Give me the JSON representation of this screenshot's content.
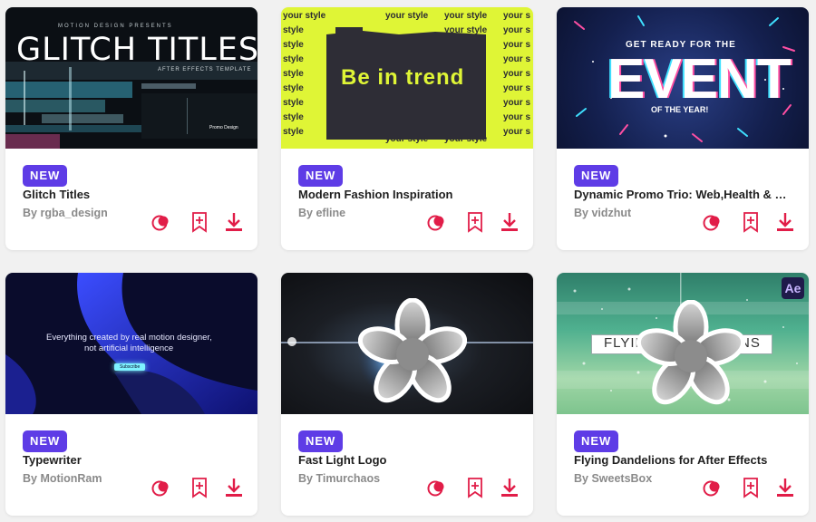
{
  "colors": {
    "accent": "#e11d48",
    "badge": "#5e3ce6"
  },
  "cards": [
    {
      "badge": "NEW",
      "title": "Glitch Titles",
      "author": "By rgba_design",
      "thumb": {
        "kicker": "MOTION DESIGN PRESENTS",
        "headline": "GLITCH TITLES",
        "sub": "AFTER EFFECTS TEMPLATE",
        "corner": "Promo Design"
      }
    },
    {
      "badge": "NEW",
      "title": "Modern Fashion Inspiration",
      "author": "By efline",
      "thumb": {
        "pattern": "your style",
        "headline": "Be in trend"
      }
    },
    {
      "badge": "NEW",
      "title": "Dynamic Promo Trio: Web,Health & Creative",
      "author": "By vidzhut",
      "thumb": {
        "kicker": "GET READY FOR THE",
        "headline": "EVENT",
        "sub": "OF THE YEAR!"
      }
    },
    {
      "badge": "NEW",
      "title": "Typewriter",
      "author": "By MotionRam",
      "thumb": {
        "line1": "Everything created by real motion designer,",
        "line2": "not artificial intelligence",
        "button": "Subscribe"
      }
    },
    {
      "badge": "NEW",
      "title": "Fast Light Logo",
      "author": "By Timurchaos",
      "thumb": {}
    },
    {
      "badge": "NEW",
      "title": "Flying Dandelions for After Effects",
      "author": "By SweetsBox",
      "thumb": {
        "headline_left": "FLYIN",
        "headline_right": "NS",
        "app_badge": "Ae"
      }
    }
  ],
  "actions": {
    "icons": [
      "color-swatch-icon",
      "bookmark-add-icon",
      "download-icon"
    ]
  }
}
